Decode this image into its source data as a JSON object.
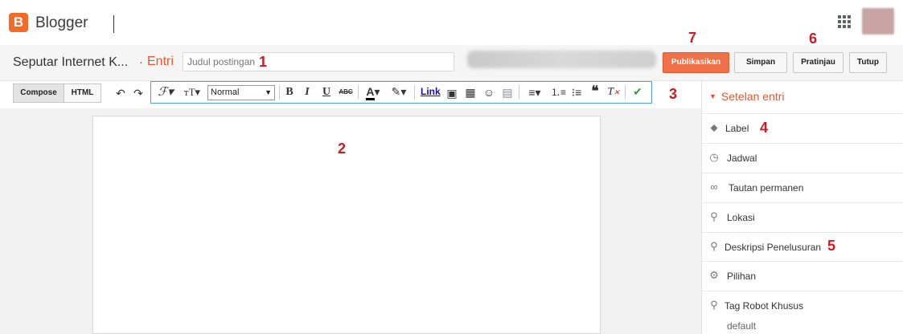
{
  "header": {
    "logo_letter": "B",
    "brand": "Blogger",
    "apps_icon": "apps-grid-icon",
    "logo_color": "#f26b28"
  },
  "title_row": {
    "blog_name": "Seputar Internet K...",
    "separator": "·",
    "section": "Entri",
    "title_placeholder": "Judul postingan",
    "title_value": "",
    "buttons": {
      "publish": "Publikasikan",
      "save": "Simpan",
      "preview": "Pratinjau",
      "close": "Tutup"
    },
    "accent": "#f07147"
  },
  "toolbar": {
    "tabs": [
      "Compose",
      "HTML"
    ],
    "font_size_value": "Normal",
    "link_label": "Link",
    "icons": [
      "undo-icon",
      "redo-icon",
      "font-family-icon",
      "font-size-icon",
      "bold-icon",
      "italic-icon",
      "underline-icon",
      "strikethrough-icon",
      "text-color-icon",
      "highlight-icon",
      "link-icon",
      "image-icon",
      "video-icon",
      "emoji-icon",
      "jump-break-icon",
      "align-icon",
      "numbered-list-icon",
      "bullet-list-icon",
      "quote-icon",
      "clear-format-icon",
      "spellcheck-icon"
    ]
  },
  "annotations": [
    "1",
    "2",
    "3",
    "4",
    "5",
    "6",
    "7"
  ],
  "sidebar": {
    "header": "Setelan entri",
    "items": [
      {
        "label": "Label",
        "icon": "tag-icon"
      },
      {
        "label": "Jadwal",
        "icon": "clock-icon"
      },
      {
        "label": "Tautan permanen",
        "icon": "link-icon"
      },
      {
        "label": "Lokasi",
        "icon": "location-pin-icon"
      },
      {
        "label": "Deskripsi Penelusuran",
        "icon": "search-icon"
      },
      {
        "label": "Pilihan",
        "icon": "gear-icon"
      },
      {
        "label": "Tag Robot Khusus",
        "icon": "search-icon"
      }
    ],
    "robot_tag_value": "default"
  }
}
